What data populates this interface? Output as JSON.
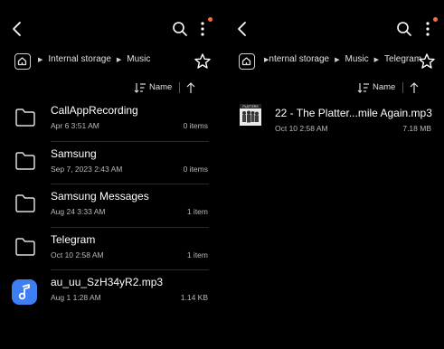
{
  "colors": {
    "background": "#000000",
    "notification_dot": "#ff6a3d",
    "music_accent": "#3d7ef5"
  },
  "left": {
    "breadcrumb": [
      "Internal storage",
      "Music"
    ],
    "sort": {
      "label": "Name"
    },
    "items": [
      {
        "type": "folder",
        "name": "CallAppRecording",
        "date": "Apr 6 3:51 AM",
        "meta": "0 items",
        "icon": "folder-icon"
      },
      {
        "type": "folder",
        "name": "Samsung",
        "date": "Sep 7, 2023 2:43 AM",
        "meta": "0 items",
        "icon": "folder-icon"
      },
      {
        "type": "folder",
        "name": "Samsung Messages",
        "date": "Aug 24 3:33 AM",
        "meta": "1 item",
        "icon": "folder-icon"
      },
      {
        "type": "folder",
        "name": "Telegram",
        "date": "Oct 10 2:58 AM",
        "meta": "1 item",
        "icon": "folder-icon"
      },
      {
        "type": "audio",
        "name": "au_uu_SzH34yR2.mp3",
        "date": "Aug 1 1:28 AM",
        "meta": "1.14 KB",
        "icon": "music-note-icon"
      }
    ]
  },
  "right": {
    "breadcrumb": [
      "nternal storage",
      "Music",
      "Telegram"
    ],
    "sort": {
      "label": "Name"
    },
    "items": [
      {
        "type": "audio",
        "name": "22 - The Platter...mile Again.mp3",
        "date": "Oct 10 2:58 AM",
        "meta": "7.18 MB",
        "icon": "album-art-thumbnail",
        "thumb_text": "PLATTERS"
      }
    ]
  }
}
